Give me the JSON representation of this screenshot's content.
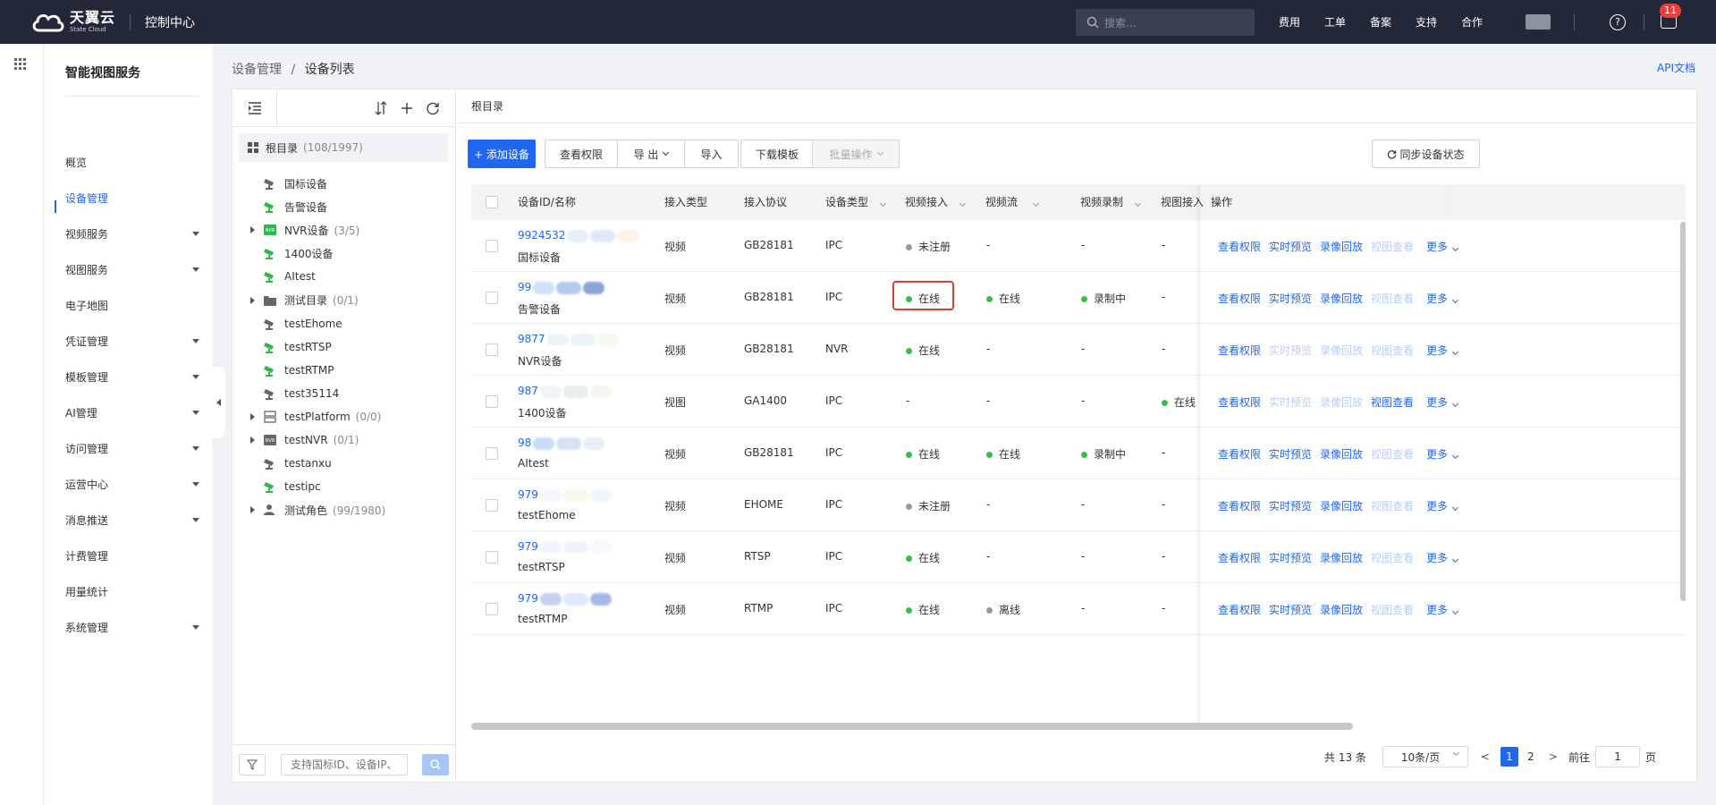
{
  "topbar": {
    "logo_cn": "天翼云",
    "logo_en": "State Cloud",
    "console": "控制中心",
    "search_placeholder": "搜索...",
    "links": [
      "费用",
      "工单",
      "备案",
      "支持",
      "合作"
    ],
    "notification_count": "11"
  },
  "sidenav": {
    "title": "智能视图服务",
    "items": [
      {
        "label": "概览",
        "expandable": false
      },
      {
        "label": "设备管理",
        "expandable": false,
        "active": true
      },
      {
        "label": "视频服务",
        "expandable": true
      },
      {
        "label": "视图服务",
        "expandable": true
      },
      {
        "label": "电子地图",
        "expandable": false
      },
      {
        "label": "凭证管理",
        "expandable": true
      },
      {
        "label": "模板管理",
        "expandable": true
      },
      {
        "label": "AI管理",
        "expandable": true
      },
      {
        "label": "访问管理",
        "expandable": true
      },
      {
        "label": "运营中心",
        "expandable": true
      },
      {
        "label": "消息推送",
        "expandable": true
      },
      {
        "label": "计费管理",
        "expandable": false
      },
      {
        "label": "用量统计",
        "expandable": false
      },
      {
        "label": "系统管理",
        "expandable": true
      }
    ]
  },
  "breadcrumb": {
    "parent": "设备管理",
    "separator": "/",
    "current": "设备列表"
  },
  "api_doc": "API文档",
  "tree": {
    "root": {
      "label": "根目录",
      "count": "(108/1997)"
    },
    "nodes": [
      {
        "label": "国标设备",
        "count": "",
        "icon": "camera-gray",
        "expandable": false
      },
      {
        "label": "告警设备",
        "count": "",
        "icon": "camera-green",
        "expandable": false
      },
      {
        "label": "NVR设备",
        "count": "(3/5)",
        "icon": "nvr-green",
        "expandable": true
      },
      {
        "label": "1400设备",
        "count": "",
        "icon": "camera-green",
        "expandable": false
      },
      {
        "label": "AItest",
        "count": "",
        "icon": "camera-green",
        "expandable": false
      },
      {
        "label": "测试目录",
        "count": "(0/1)",
        "icon": "folder",
        "expandable": true
      },
      {
        "label": "testEhome",
        "count": "",
        "icon": "camera-gray",
        "expandable": false
      },
      {
        "label": "testRTSP",
        "count": "",
        "icon": "camera-green",
        "expandable": false
      },
      {
        "label": "testRTMP",
        "count": "",
        "icon": "camera-green",
        "expandable": false
      },
      {
        "label": "test35114",
        "count": "",
        "icon": "camera-gray",
        "expandable": false
      },
      {
        "label": "testPlatform",
        "count": "(0/0)",
        "icon": "platform",
        "expandable": true
      },
      {
        "label": "testNVR",
        "count": "(0/1)",
        "icon": "nvr-gray",
        "expandable": true
      },
      {
        "label": "testanxu",
        "count": "",
        "icon": "camera-gray",
        "expandable": false
      },
      {
        "label": "testipc",
        "count": "",
        "icon": "camera-green",
        "expandable": false
      },
      {
        "label": "测试角色",
        "count": "(99/1980)",
        "icon": "role",
        "expandable": true
      }
    ],
    "search_placeholder": "支持国标ID、设备IP、"
  },
  "content": {
    "dir_title": "根目录",
    "toolbar": {
      "add": "+ 添加设备",
      "view_perm": "查看权限",
      "export": "导 出",
      "import": "导入",
      "download_template": "下载模板",
      "batch": "批量操作",
      "sync": "同步设备状态"
    },
    "columns": [
      "设备ID/名称",
      "接入类型",
      "接入协议",
      "设备类型",
      "视频接入",
      "视频流",
      "视频录制",
      "视图接入",
      "操作"
    ],
    "rows": [
      {
        "id": "9924532",
        "name": "国标设备",
        "access_type": "视频",
        "protocol": "GB28181",
        "device_type": "IPC",
        "video_access": "未注册",
        "va_status": "gray",
        "stream": "-",
        "s_status": "",
        "record": "-",
        "r_status": "",
        "view_access": "-",
        "v_status": "",
        "ops": [
          true,
          true,
          true,
          false
        ]
      },
      {
        "id": "99",
        "name": "告警设备",
        "access_type": "视频",
        "protocol": "GB28181",
        "device_type": "IPC",
        "video_access": "在线",
        "va_status": "green",
        "stream": "在线",
        "s_status": "green",
        "record": "录制中",
        "r_status": "green",
        "view_access": "-",
        "v_status": "",
        "ops": [
          true,
          true,
          true,
          false
        ]
      },
      {
        "id": "9877",
        "name": "NVR设备",
        "access_type": "视频",
        "protocol": "GB28181",
        "device_type": "NVR",
        "video_access": "在线",
        "va_status": "green",
        "stream": "-",
        "s_status": "",
        "record": "-",
        "r_status": "",
        "view_access": "-",
        "v_status": "",
        "ops": [
          true,
          false,
          false,
          false
        ]
      },
      {
        "id": "987",
        "name": "1400设备",
        "access_type": "视图",
        "protocol": "GA1400",
        "device_type": "IPC",
        "video_access": "-",
        "va_status": "",
        "stream": "-",
        "s_status": "",
        "record": "-",
        "r_status": "",
        "view_access": "在线",
        "v_status": "green",
        "ops": [
          true,
          false,
          false,
          true
        ]
      },
      {
        "id": "98",
        "name": "AItest",
        "access_type": "视频",
        "protocol": "GB28181",
        "device_type": "IPC",
        "video_access": "在线",
        "va_status": "green",
        "stream": "在线",
        "s_status": "green",
        "record": "录制中",
        "r_status": "green",
        "view_access": "-",
        "v_status": "",
        "ops": [
          true,
          true,
          true,
          false
        ]
      },
      {
        "id": "979",
        "name": "testEhome",
        "access_type": "视频",
        "protocol": "EHOME",
        "device_type": "IPC",
        "video_access": "未注册",
        "va_status": "gray",
        "stream": "-",
        "s_status": "",
        "record": "-",
        "r_status": "",
        "view_access": "-",
        "v_status": "",
        "ops": [
          true,
          true,
          true,
          false
        ]
      },
      {
        "id": "979",
        "name": "testRTSP",
        "access_type": "视频",
        "protocol": "RTSP",
        "device_type": "IPC",
        "video_access": "在线",
        "va_status": "green",
        "stream": "-",
        "s_status": "",
        "record": "-",
        "r_status": "",
        "view_access": "-",
        "v_status": "",
        "ops": [
          true,
          true,
          true,
          false
        ]
      },
      {
        "id": "979",
        "name": "testRTMP",
        "access_type": "视频",
        "protocol": "RTMP",
        "device_type": "IPC",
        "video_access": "在线",
        "va_status": "green",
        "stream": "离线",
        "s_status": "gray",
        "record": "-",
        "r_status": "",
        "view_access": "-",
        "v_status": "",
        "ops": [
          true,
          true,
          true,
          false
        ]
      }
    ],
    "op_labels": [
      "查看权限",
      "实时预览",
      "录像回放",
      "视图查看"
    ],
    "more": "更多",
    "pagination": {
      "total": "共 13 条",
      "page_size": "10条/页",
      "pages": [
        "1",
        "2"
      ],
      "current": "1",
      "goto_prefix": "前往",
      "goto_value": "1",
      "goto_suffix": "页"
    },
    "colors": {
      "accent": "#2066ee",
      "online": "#32c04a",
      "offline": "#999999",
      "highlight": "#e8392e"
    }
  }
}
